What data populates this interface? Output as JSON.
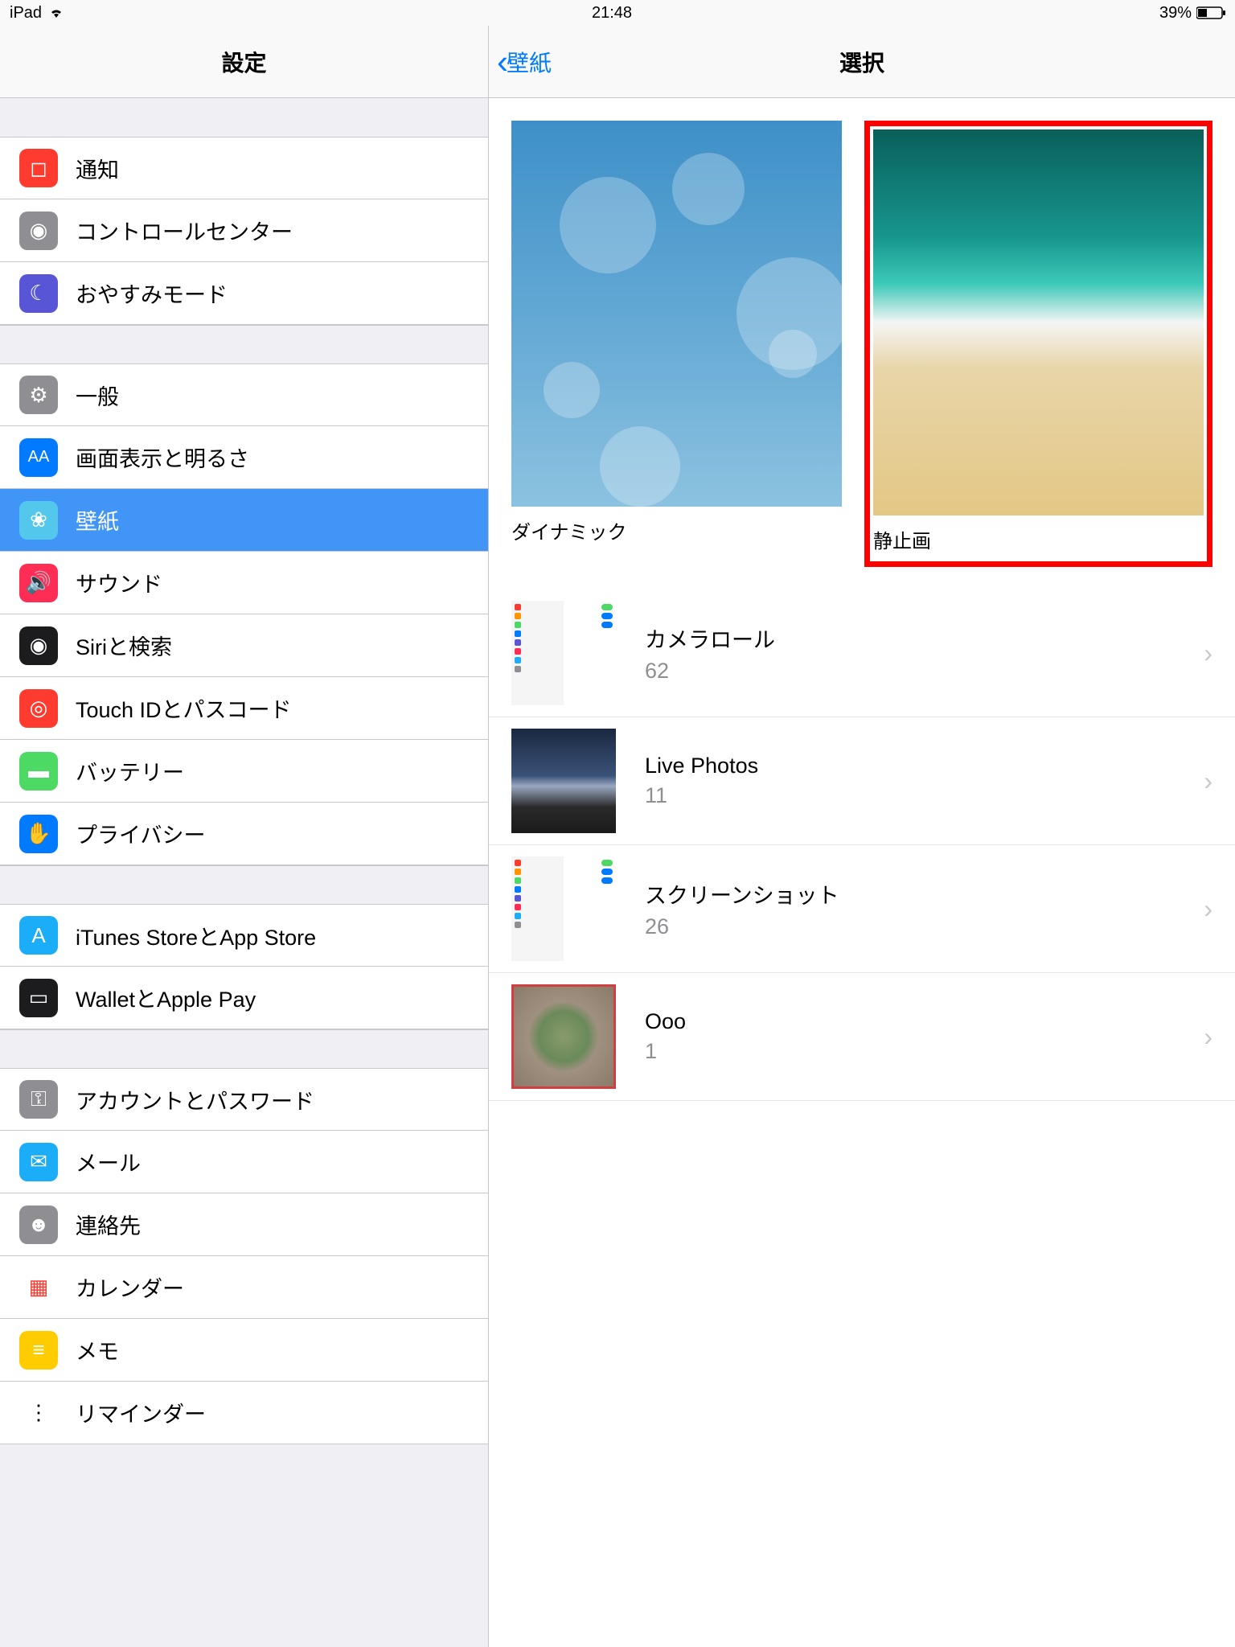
{
  "status": {
    "device": "iPad",
    "time": "21:48",
    "battery_pct": "39%"
  },
  "sidebar": {
    "title": "設定",
    "groups": [
      [
        {
          "id": "notifications",
          "label": "通知",
          "color": "#ff3b30",
          "glyph": "◻"
        },
        {
          "id": "control-center",
          "label": "コントロールセンター",
          "color": "#8e8e93",
          "glyph": "◉"
        },
        {
          "id": "dnd",
          "label": "おやすみモード",
          "color": "#5856d6",
          "glyph": "☾"
        }
      ],
      [
        {
          "id": "general",
          "label": "一般",
          "color": "#8e8e93",
          "glyph": "⚙"
        },
        {
          "id": "display",
          "label": "画面表示と明るさ",
          "color": "#007aff",
          "glyph": "AA"
        },
        {
          "id": "wallpaper",
          "label": "壁紙",
          "color": "#54c7ec",
          "glyph": "❀",
          "selected": true
        },
        {
          "id": "sounds",
          "label": "サウンド",
          "color": "#ff2d55",
          "glyph": "🔊"
        },
        {
          "id": "siri",
          "label": "Siriと検索",
          "color": "#1c1c1e",
          "glyph": "◉"
        },
        {
          "id": "touchid",
          "label": "Touch IDとパスコード",
          "color": "#ff3b30",
          "glyph": "◎"
        },
        {
          "id": "battery",
          "label": "バッテリー",
          "color": "#4cd964",
          "glyph": "▬"
        },
        {
          "id": "privacy",
          "label": "プライバシー",
          "color": "#007aff",
          "glyph": "✋"
        }
      ],
      [
        {
          "id": "itunes",
          "label": "iTunes StoreとApp Store",
          "color": "#1badf8",
          "glyph": "A"
        },
        {
          "id": "wallet",
          "label": "WalletとApple Pay",
          "color": "#1c1c1e",
          "glyph": "▭"
        }
      ],
      [
        {
          "id": "accounts",
          "label": "アカウントとパスワード",
          "color": "#8e8e93",
          "glyph": "⚿"
        },
        {
          "id": "mail",
          "label": "メール",
          "color": "#1badf8",
          "glyph": "✉"
        },
        {
          "id": "contacts",
          "label": "連絡先",
          "color": "#8e8e93",
          "glyph": "☻"
        },
        {
          "id": "calendar",
          "label": "カレンダー",
          "color": "#ffffff",
          "glyph": "▦",
          "fg": "#ff3b30"
        },
        {
          "id": "notes",
          "label": "メモ",
          "color": "#ffcc00",
          "glyph": "≡",
          "fg": "#fff"
        },
        {
          "id": "reminders",
          "label": "リマインダー",
          "color": "#ffffff",
          "glyph": "⋮",
          "fg": "#000"
        }
      ]
    ]
  },
  "detail": {
    "back_label": "壁紙",
    "title": "選択",
    "wallpaper_types": [
      {
        "id": "dynamic",
        "label": "ダイナミック",
        "highlight": false
      },
      {
        "id": "still",
        "label": "静止画",
        "highlight": true
      }
    ],
    "albums": [
      {
        "id": "cameraroll",
        "title": "カメラロール",
        "count": "62",
        "thumb": "settings"
      },
      {
        "id": "livephotos",
        "title": "Live Photos",
        "count": "11",
        "thumb": "sky"
      },
      {
        "id": "screenshots",
        "title": "スクリーンショット",
        "count": "26",
        "thumb": "settings"
      },
      {
        "id": "ooo",
        "title": "Ooo",
        "count": "1",
        "thumb": "stadium"
      }
    ]
  }
}
